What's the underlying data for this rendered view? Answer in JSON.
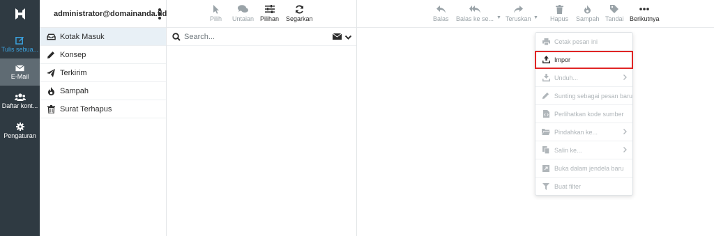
{
  "rail": {
    "compose_label": "Tulis sebua...",
    "mail_label": "E-Mail",
    "contacts_label": "Daftar kont...",
    "settings_label": "Pengaturan"
  },
  "account": {
    "email": "administrator@domainanda.tld"
  },
  "folders": [
    {
      "label": "Kotak Masuk",
      "icon": "inbox-icon",
      "active": true
    },
    {
      "label": "Konsep",
      "icon": "pencil-icon"
    },
    {
      "label": "Terkirim",
      "icon": "paper-plane-icon"
    },
    {
      "label": "Sampah",
      "icon": "fire-icon"
    },
    {
      "label": "Surat Terhapus",
      "icon": "trash-icon"
    }
  ],
  "list_toolbar": {
    "select": "Pilih",
    "threads": "Untaian",
    "options": "Pilihan",
    "refresh": "Segarkan"
  },
  "search": {
    "placeholder": "Search..."
  },
  "preview_toolbar": {
    "reply": "Balas",
    "reply_all": "Balas ke se...",
    "forward": "Teruskan",
    "delete": "Hapus",
    "spam": "Sampah",
    "mark": "Tandai",
    "more": "Berikutnya"
  },
  "more_menu": [
    {
      "label": "Cetak pesan ini",
      "icon": "print-icon"
    },
    {
      "label": "Impor",
      "icon": "upload-icon",
      "enabled": true,
      "highlighted": true
    },
    {
      "label": "Unduh...",
      "icon": "download-icon",
      "submenu": true
    },
    {
      "label": "Sunting sebagai pesan baru",
      "icon": "pencil-icon"
    },
    {
      "label": "Perlihatkan kode sumber",
      "icon": "file-code-icon"
    },
    {
      "label": "Pindahkan ke...",
      "icon": "folder-icon",
      "submenu": true
    },
    {
      "label": "Salin ke...",
      "icon": "copy-icon",
      "submenu": true
    },
    {
      "label": "Buka dalam jendela baru",
      "icon": "external-window-icon"
    },
    {
      "label": "Buat filter",
      "icon": "filter-icon"
    }
  ],
  "colors": {
    "rail_bg": "#2f3a42",
    "rail_active": "#5f6b73",
    "accent": "#3ba3e0",
    "highlight_border": "#e02424"
  }
}
